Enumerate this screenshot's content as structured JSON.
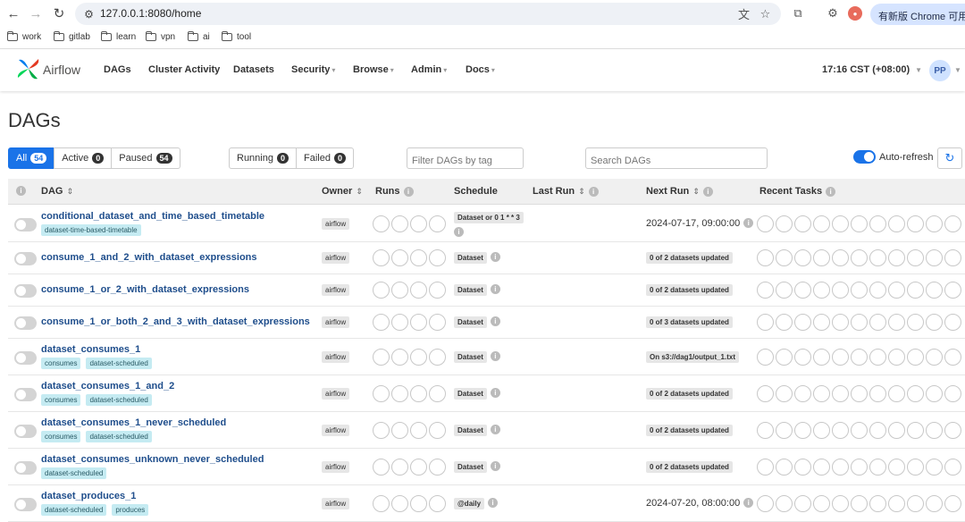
{
  "browser": {
    "url": "127.0.0.1:8080/home",
    "update_button": "有新版 Chrome 可用",
    "bookmarks": [
      "work",
      "gitlab",
      "learn",
      "vpn",
      "ai",
      "tool"
    ]
  },
  "navbar": {
    "brand": "Airflow",
    "items": [
      {
        "label": "DAGs",
        "dropdown": false
      },
      {
        "label": "Cluster Activity",
        "dropdown": false
      },
      {
        "label": "Datasets",
        "dropdown": false
      },
      {
        "label": "Security",
        "dropdown": true
      },
      {
        "label": "Browse",
        "dropdown": true
      },
      {
        "label": "Admin",
        "dropdown": true
      },
      {
        "label": "Docs",
        "dropdown": true
      }
    ],
    "time": "17:16 CST (+08:00)",
    "user_initials": "PP"
  },
  "page": {
    "title": "DAGs",
    "status_filters": [
      {
        "label": "All",
        "count": "54",
        "active": true
      },
      {
        "label": "Active",
        "count": "0",
        "active": false
      },
      {
        "label": "Paused",
        "count": "54",
        "active": false
      }
    ],
    "run_filters": [
      {
        "label": "Running",
        "count": "0"
      },
      {
        "label": "Failed",
        "count": "0"
      }
    ],
    "tag_filter_placeholder": "Filter DAGs by tag",
    "search_placeholder": "Search DAGs",
    "auto_refresh_label": "Auto-refresh",
    "auto_refresh_on": true
  },
  "table": {
    "headers": {
      "dag": "DAG",
      "owner": "Owner",
      "runs": "Runs",
      "schedule": "Schedule",
      "last_run": "Last Run",
      "next_run": "Next Run",
      "recent_tasks": "Recent Tasks"
    },
    "rows": [
      {
        "name": "conditional_dataset_and_time_based_timetable",
        "tags": [
          "dataset-time-based-timetable"
        ],
        "owner": "airflow",
        "schedule": "Dataset or 0 1 * * 3",
        "next_run": "2024-07-17, 09:00:00",
        "next_run_badge": false
      },
      {
        "name": "consume_1_and_2_with_dataset_expressions",
        "tags": [],
        "owner": "airflow",
        "schedule": "Dataset",
        "next_run": "0 of 2 datasets updated",
        "next_run_badge": true
      },
      {
        "name": "consume_1_or_2_with_dataset_expressions",
        "tags": [],
        "owner": "airflow",
        "schedule": "Dataset",
        "next_run": "0 of 2 datasets updated",
        "next_run_badge": true
      },
      {
        "name": "consume_1_or_both_2_and_3_with_dataset_expressions",
        "tags": [],
        "owner": "airflow",
        "schedule": "Dataset",
        "next_run": "0 of 3 datasets updated",
        "next_run_badge": true
      },
      {
        "name": "dataset_consumes_1",
        "tags": [
          "consumes",
          "dataset-scheduled"
        ],
        "owner": "airflow",
        "schedule": "Dataset",
        "next_run": "On s3://dag1/output_1.txt",
        "next_run_badge": true
      },
      {
        "name": "dataset_consumes_1_and_2",
        "tags": [
          "consumes",
          "dataset-scheduled"
        ],
        "owner": "airflow",
        "schedule": "Dataset",
        "next_run": "0 of 2 datasets updated",
        "next_run_badge": true
      },
      {
        "name": "dataset_consumes_1_never_scheduled",
        "tags": [
          "consumes",
          "dataset-scheduled"
        ],
        "owner": "airflow",
        "schedule": "Dataset",
        "next_run": "0 of 2 datasets updated",
        "next_run_badge": true
      },
      {
        "name": "dataset_consumes_unknown_never_scheduled",
        "tags": [
          "dataset-scheduled"
        ],
        "owner": "airflow",
        "schedule": "Dataset",
        "next_run": "0 of 2 datasets updated",
        "next_run_badge": true
      },
      {
        "name": "dataset_produces_1",
        "tags": [
          "dataset-scheduled",
          "produces"
        ],
        "owner": "airflow",
        "schedule": "@daily",
        "next_run": "2024-07-20, 08:00:00",
        "next_run_badge": false
      }
    ]
  },
  "colors": {
    "accent": "#1a73e8",
    "dag_link": "#1f4e8c",
    "tag_bg": "#c5ebf2"
  }
}
